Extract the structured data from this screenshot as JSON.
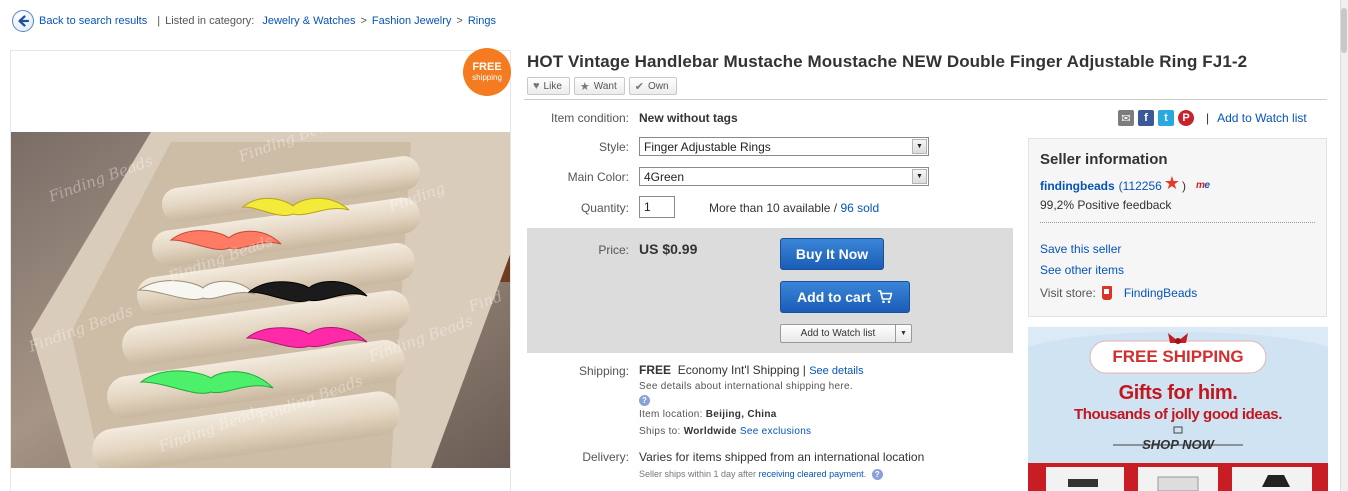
{
  "breadcrumb": {
    "back_label": "Back to search results",
    "listed_label": "Listed in category:",
    "categories": [
      "Jewelry & Watches",
      "Fashion Jewelry",
      "Rings"
    ],
    "separator": ">",
    "divider": "|"
  },
  "image": {
    "badge_line1": "FREE",
    "badge_line2": "shipping",
    "watermark": "Finding Beads"
  },
  "item": {
    "title": "HOT Vintage Handlebar Mustache Moustache NEW Double Finger Adjustable Ring FJ1-2",
    "social": [
      {
        "label": "Like",
        "icon": "heart-icon"
      },
      {
        "label": "Want",
        "icon": "star-icon"
      },
      {
        "label": "Own",
        "icon": "check-icon"
      }
    ]
  },
  "share": {
    "divider": "|",
    "watch_label": "Add to Watch list"
  },
  "specifics": {
    "condition_label": "Item condition:",
    "condition_value": "New without tags",
    "style_label": "Style:",
    "style_value": "Finger Adjustable Rings",
    "color_label": "Main Color:",
    "color_value": "4Green",
    "quantity_label": "Quantity:",
    "quantity_value": "1",
    "availability": "More than 10 available",
    "availability_sep": "/",
    "sold": "96 sold"
  },
  "purchase": {
    "price_label": "Price:",
    "price_value": "US $0.99",
    "buy_now": "Buy It Now",
    "add_to_cart": "Add to cart",
    "watch_button": "Add to Watch list"
  },
  "shipping": {
    "label": "Shipping:",
    "cost": "FREE",
    "service": "Economy Int'l Shipping",
    "divider": "|",
    "details_link": "See details",
    "intl_note": "See details about international shipping here.",
    "location_label": "Item location:",
    "location_value": "Beijing, China",
    "ships_to_label": "Ships to:",
    "ships_to_value": "Worldwide",
    "exclusions_link": "See exclusions"
  },
  "delivery": {
    "label": "Delivery:",
    "main": "Varies for items shipped from an international location",
    "sub_prefix": "Seller ships within 1 day after",
    "sub_link": "receiving cleared payment",
    "sub_suffix": "."
  },
  "seller": {
    "title": "Seller information",
    "name": "findingbeads",
    "score": "(112256",
    "score_close": ")",
    "feedback": "99,2% Positive feedback",
    "save_link": "Save this seller",
    "other_items_link": "See other items",
    "visit_label": "Visit store:",
    "store_name": "FindingBeads"
  },
  "ad": {
    "free_shipping": "FREE SHIPPING",
    "headline": "Gifts for him.",
    "subline": "Thousands of jolly good ideas.",
    "cta": "SHOP NOW"
  },
  "colors": {
    "link": "#0654ba",
    "buy_button": "#2a6ec6",
    "badge": "#f47b20",
    "price_box": "#dcdcdc",
    "ad_red": "#c4161c"
  }
}
